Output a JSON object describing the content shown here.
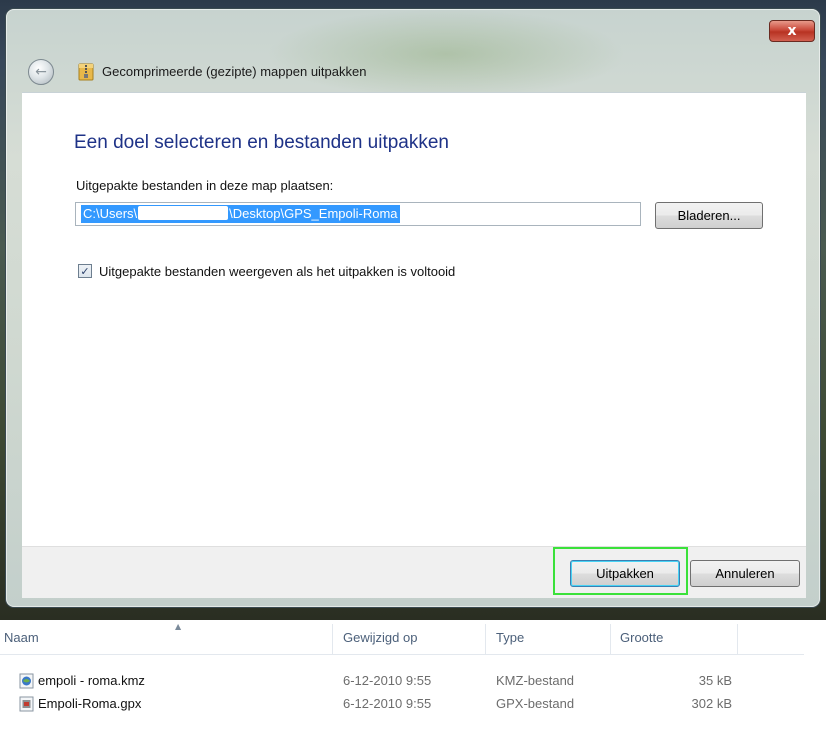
{
  "window": {
    "title": "Gecomprimeerde (gezipte) mappen uitpakken",
    "close_glyph": "x"
  },
  "dialog": {
    "heading": "Een doel selecteren en bestanden uitpakken",
    "destination_label": "Uitgepakte bestanden in deze map plaatsen:",
    "path_prefix": "C:\\Users\\",
    "path_suffix": "\\Desktop\\GPS_Empoli-Roma",
    "browse_label": "Bladeren...",
    "show_files_label": "Uitgepakte bestanden weergeven als het uitpakken is voltooid",
    "show_files_checked": true
  },
  "footer": {
    "extract_label": "Uitpakken",
    "cancel_label": "Annuleren",
    "highlight_color": "#3ae13a"
  },
  "file_list": {
    "columns": [
      "Naam",
      "Gewijzigd op",
      "Type",
      "Grootte"
    ],
    "rows": [
      {
        "icon": "kmz-file-icon",
        "name": "empoli - roma.kmz",
        "date": "6-12-2010 9:55",
        "type": "KMZ-bestand",
        "size": "35 kB"
      },
      {
        "icon": "gpx-file-icon",
        "name": "Empoli-Roma.gpx",
        "date": "6-12-2010 9:55",
        "type": "GPX-bestand",
        "size": "302 kB"
      }
    ]
  },
  "icons": {
    "back": "back-arrow-icon",
    "zip": "zip-folder-icon",
    "check": "checkmark-icon",
    "close": "close-icon"
  },
  "colors": {
    "heading": "#1e3287",
    "selection": "#3399ff",
    "close_button": "#c9493a"
  }
}
